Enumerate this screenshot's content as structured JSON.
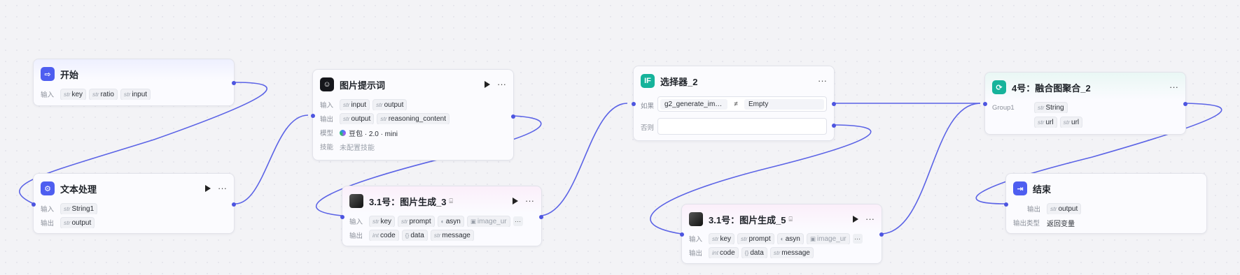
{
  "colors": {
    "accent": "#4d55e0",
    "edge": "#5b63e6"
  },
  "nodes": {
    "start": {
      "icon": "start-icon",
      "title": "开始",
      "inputs_label": "输入",
      "inputs": [
        {
          "type": "str",
          "name": "key"
        },
        {
          "type": "str",
          "name": "ratio"
        },
        {
          "type": "str",
          "name": "input"
        }
      ]
    },
    "text": {
      "icon": "text-processing-icon",
      "title": "文本处理",
      "inputs_label": "输入",
      "outputs_label": "输出",
      "inputs": [
        {
          "type": "str",
          "name": "String1"
        }
      ],
      "outputs": [
        {
          "type": "str",
          "name": "output"
        }
      ]
    },
    "prompt": {
      "icon": "llm-icon",
      "title": "图片提示词",
      "inputs_label": "输入",
      "outputs_label": "输出",
      "model_label": "模型",
      "skills_label": "技能",
      "inputs": [
        {
          "type": "str",
          "name": "input"
        },
        {
          "type": "str",
          "name": "output"
        }
      ],
      "outputs": [
        {
          "type": "str",
          "name": "output"
        },
        {
          "type": "str",
          "name": "reasoning_content"
        }
      ],
      "model": "豆包 · 2.0 · mini",
      "skills": "未配置技能"
    },
    "gen3": {
      "icon": "image-gen-icon",
      "title": "3.1号：图片生成_3",
      "inputs_label": "输入",
      "outputs_label": "输出",
      "inputs": [
        {
          "type": "str",
          "name": "key"
        },
        {
          "type": "str",
          "name": "prompt"
        },
        {
          "type": "toggle",
          "name": "asyn"
        },
        {
          "type": "img",
          "name": "image_ur"
        }
      ],
      "outputs": [
        {
          "type": "int",
          "name": "code"
        },
        {
          "type": "{}",
          "name": "data"
        },
        {
          "type": "str",
          "name": "message"
        }
      ],
      "more": "···"
    },
    "selector": {
      "icon": "if-icon",
      "icon_text": "IF",
      "title": "选择器_2",
      "if_label": "如果",
      "else_label": "否则",
      "variable": "g2_generate_ima···",
      "operator": "≠",
      "value": "Empty"
    },
    "gen5": {
      "icon": "image-gen-icon",
      "title": "3.1号：图片生成_5",
      "inputs_label": "输入",
      "outputs_label": "输出",
      "inputs": [
        {
          "type": "str",
          "name": "key"
        },
        {
          "type": "str",
          "name": "prompt"
        },
        {
          "type": "toggle",
          "name": "asyn"
        },
        {
          "type": "img",
          "name": "image_ur"
        }
      ],
      "outputs": [
        {
          "type": "int",
          "name": "code"
        },
        {
          "type": "{}",
          "name": "data"
        },
        {
          "type": "str",
          "name": "message"
        }
      ],
      "more": "···"
    },
    "merge": {
      "icon": "merge-icon",
      "title": "4号：融合图聚合_2",
      "group_label": "Group1",
      "group": [
        {
          "type": "str",
          "name": "String"
        }
      ],
      "group2": [
        {
          "type": "str",
          "name": "url"
        },
        {
          "type": "str",
          "name": "url"
        }
      ]
    },
    "end": {
      "icon": "end-icon",
      "title": "结束",
      "outputs_label": "输出",
      "output_type_label": "输出类型",
      "outputs": [
        {
          "type": "str",
          "name": "output"
        }
      ],
      "output_type": "返回变量"
    }
  }
}
